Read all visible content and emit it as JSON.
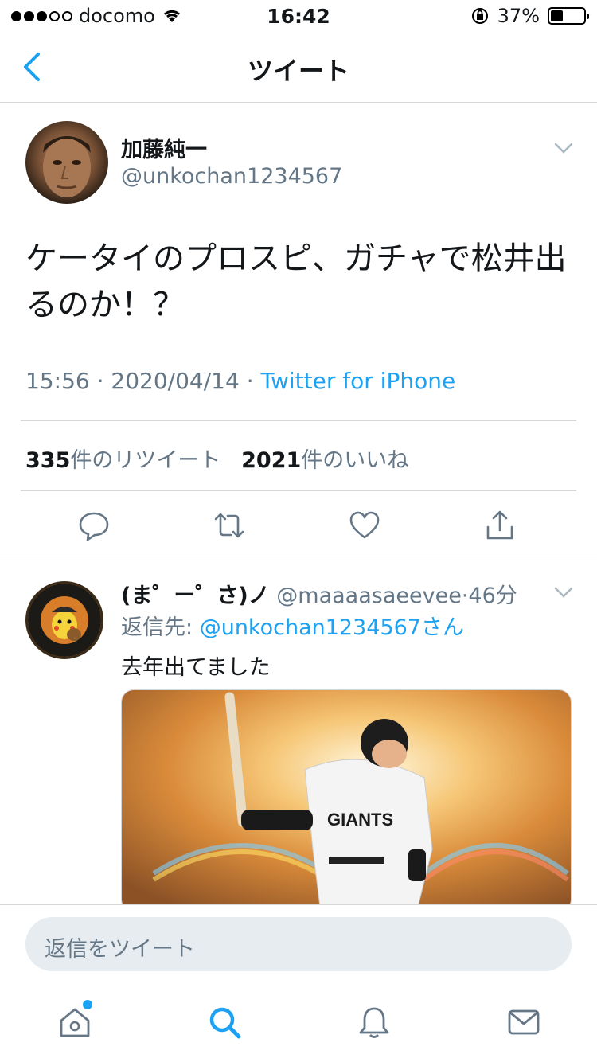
{
  "status_bar": {
    "carrier": "docomo",
    "time": "16:42",
    "battery": "37%",
    "battery_level": 0.37
  },
  "nav": {
    "title": "ツイート"
  },
  "tweet": {
    "author_name": "加藤純一",
    "author_handle": "@unkochan1234567",
    "text": "ケータイのプロスピ、ガチャで松井出るのか！？",
    "time": "15:56",
    "date": "2020/04/14",
    "source": "Twitter for iPhone",
    "retweet_count": "335",
    "retweet_label": "件のリツイート",
    "like_count": "2021",
    "like_label": "件のいいね"
  },
  "reply": {
    "author_name": "(ま゜ー゜さ)ノ",
    "author_handle": "@maaaasaeevee",
    "time": "46分",
    "reply_to_label": "返信先:",
    "reply_to_handle": "@unkochan1234567さん",
    "text": "去年出てました",
    "media_jersey": "GIANTS"
  },
  "composer": {
    "placeholder": "返信をツイート"
  },
  "tabs": [
    {
      "icon": "home-icon"
    },
    {
      "icon": "search-icon"
    },
    {
      "icon": "notifications-icon"
    },
    {
      "icon": "messages-icon"
    }
  ],
  "colors": {
    "accent": "#1da1f2",
    "secondary_text": "#657786",
    "divider": "#d6d6d6"
  }
}
